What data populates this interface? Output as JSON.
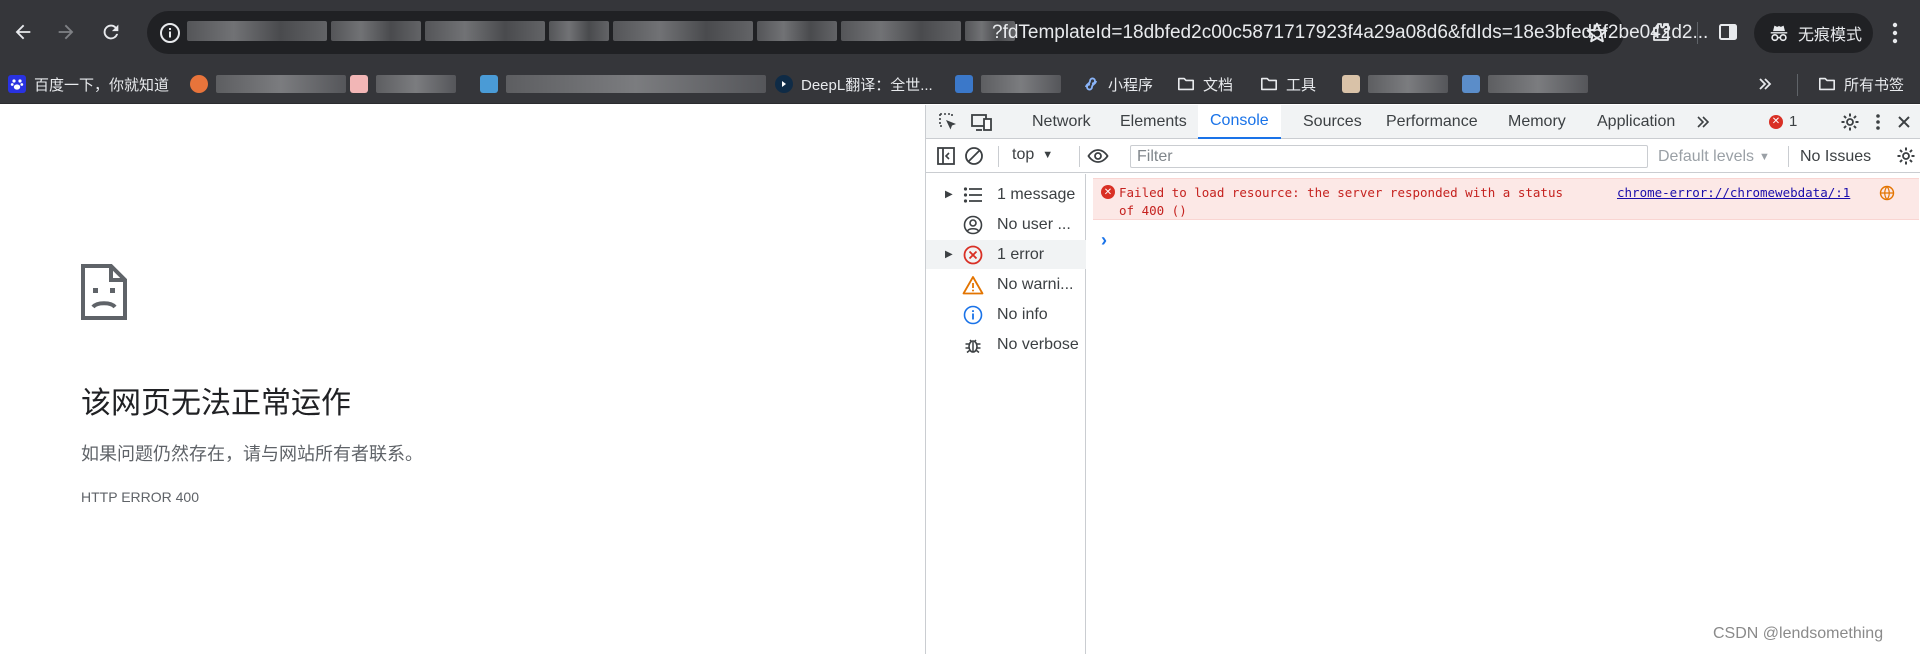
{
  "browser": {
    "url_visible": "?fdTemplateId=18dbfed2c00c5871717923f4a29a08d6&fdIds=18e3bfed5f2be042d2...",
    "incognito_label": "无痕模式",
    "icons": {
      "back": "back-arrow-icon",
      "forward": "forward-arrow-icon",
      "reload": "reload-icon",
      "site_info": "info-icon",
      "bookmark_star": "star-icon",
      "extensions": "puzzle-icon",
      "side_panel": "side-panel-icon",
      "menu": "kebab-menu-icon"
    }
  },
  "bookmarks": {
    "items": [
      {
        "label": "百度一下，你就知道",
        "icon": "baidu-paw-icon"
      },
      {
        "label": "DeepL翻译：全世...",
        "icon": "deepl-icon"
      },
      {
        "label": "小程序",
        "icon": "miniapp-icon"
      },
      {
        "label": "文档",
        "icon": "folder-icon"
      },
      {
        "label": "工具",
        "icon": "folder-icon"
      }
    ],
    "more_icon": "chevron-double-right-icon",
    "all_bookmarks_label": "所有书签"
  },
  "error_page": {
    "title": "该网页无法正常运作",
    "description": "如果问题仍然存在，请与网站所有者联系。",
    "code": "HTTP ERROR 400",
    "icon": "sad-page-icon"
  },
  "devtools": {
    "tabs": [
      {
        "label": "Network",
        "active": false
      },
      {
        "label": "Elements",
        "active": false
      },
      {
        "label": "Console",
        "active": true
      },
      {
        "label": "Sources",
        "active": false
      },
      {
        "label": "Performance",
        "active": false
      },
      {
        "label": "Memory",
        "active": false
      },
      {
        "label": "Application",
        "active": false
      }
    ],
    "error_count": "1",
    "toolbar": {
      "context": "top",
      "filter_placeholder": "Filter",
      "levels": "Default levels",
      "issues": "No Issues"
    },
    "sidebar": [
      {
        "label": "1 message",
        "icon": "list-icon",
        "expandable": true
      },
      {
        "label": "No user ...",
        "icon": "user-icon",
        "expandable": false
      },
      {
        "label": "1 error",
        "icon": "error-icon",
        "expandable": true
      },
      {
        "label": "No warni...",
        "icon": "warning-icon",
        "expandable": false
      },
      {
        "label": "No info",
        "icon": "info-icon",
        "expandable": false
      },
      {
        "label": "No verbose",
        "icon": "bug-icon",
        "expandable": false
      }
    ],
    "messages": [
      {
        "level": "error",
        "text_line1": "Failed to load resource: the server responded with a status",
        "text_line2": "of 400 ()",
        "source": "chrome-error://chromewebdata/:1"
      }
    ],
    "colors": {
      "accent": "#1a73e8",
      "error": "#d93025",
      "error_bg": "#fce8e6",
      "warning": "#e37400"
    }
  },
  "watermark": "CSDN @lendsomething"
}
